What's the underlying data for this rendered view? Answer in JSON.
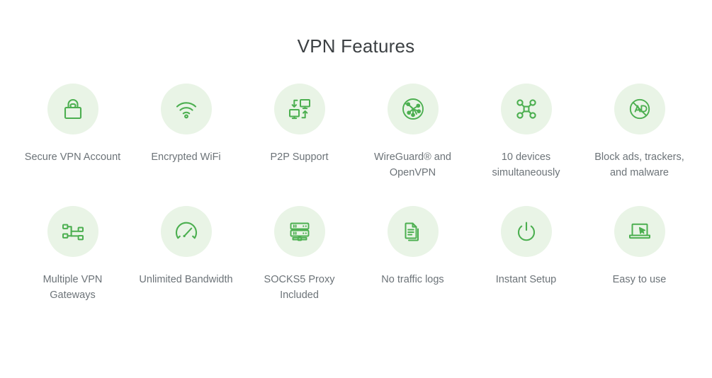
{
  "page": {
    "title": "VPN Features",
    "background_color": "#ffffff",
    "title_color": "#3c4043",
    "badge_color": "#e9f4e6",
    "icon_color": "#4caf50",
    "label_color": "#6c7378"
  },
  "features": [
    {
      "label": "Secure VPN Account",
      "icon": "padlock-icon"
    },
    {
      "label": "Encrypted WiFi",
      "icon": "wifi-icon"
    },
    {
      "label": "P2P Support",
      "icon": "two-monitors-exchange-icon"
    },
    {
      "label": "WireGuard® and OpenVPN",
      "icon": "globe-network-icon"
    },
    {
      "label": "10 devices simultaneously",
      "icon": "hub-nodes-icon"
    },
    {
      "label": "Block ads, trackers, and malware",
      "icon": "no-ads-icon"
    },
    {
      "label": "Multiple VPN Gateways",
      "icon": "sitemap-icon"
    },
    {
      "label": "Unlimited Bandwidth",
      "icon": "speedometer-icon"
    },
    {
      "label": "SOCKS5 Proxy Included",
      "icon": "server-rack-icon"
    },
    {
      "label": "No traffic logs",
      "icon": "documents-stack-icon"
    },
    {
      "label": "Instant Setup",
      "icon": "power-button-icon"
    },
    {
      "label": "Easy to use",
      "icon": "laptop-cursor-icon"
    }
  ]
}
